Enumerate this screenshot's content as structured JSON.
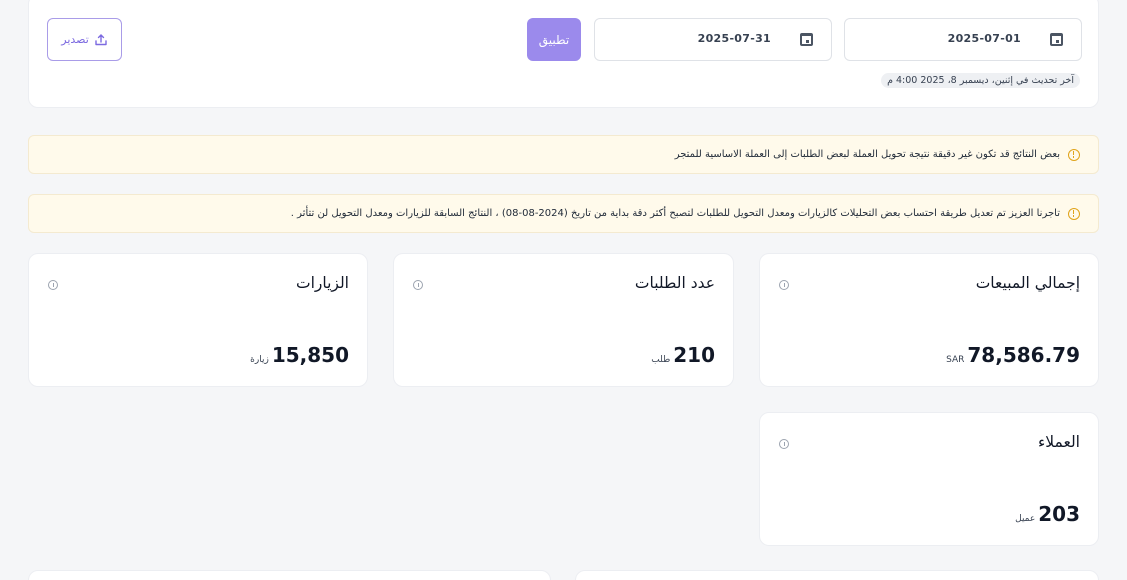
{
  "filter": {
    "start_date": "2025-07-01",
    "end_date": "2025-07-31",
    "apply_label": "تطبيق",
    "export_label": "تصدير",
    "last_update": "آخر تحديث في إثنين، ديسمبر 8، 2025 4:00 م"
  },
  "alerts": [
    {
      "text": "بعض النتائج قد تكون غير دقيقة نتيجة تحويل العملة لبعض الطلبات إلى العملة الاساسية للمتجر"
    },
    {
      "text": "تاجرنا العزيز تم تعديل طريقة احتساب بعض التحليلات كالزيارات ومعدل التحويل للطلبات لتصبح أكثر دقة بداية من تاريخ (2024-08-08) ، النتائج السابقة للزيارات ومعدل التحويل لن تتأثر ."
    }
  ],
  "kpis": [
    {
      "title": "إجمالي المبيعات",
      "value": "78,586.79",
      "unit": "SAR"
    },
    {
      "title": "عدد الطلبات",
      "value": "210",
      "unit": "طلب"
    },
    {
      "title": "الزيارات",
      "value": "15,850",
      "unit": "زيارة"
    },
    {
      "title": "العملاء",
      "value": "203",
      "unit": "عميل"
    }
  ],
  "icons": {
    "calendar": "calendar-icon",
    "upload": "upload-icon",
    "warning": "warning-icon",
    "info": "info-icon"
  },
  "colors": {
    "accent": "#9b8aec",
    "alert_bg": "#fffaeb",
    "warning": "#e0a31a"
  }
}
